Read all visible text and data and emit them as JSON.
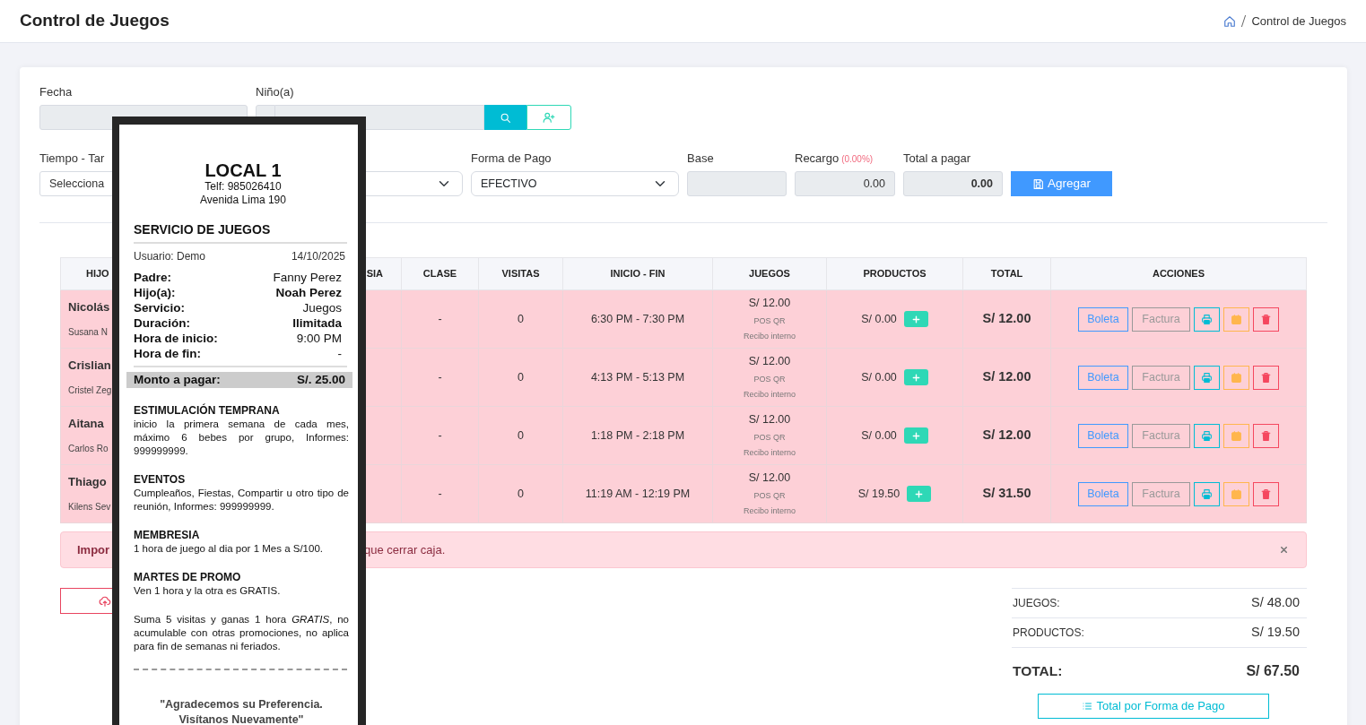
{
  "header": {
    "title": "Control de Juegos",
    "breadcrumb": [
      "Control de Juegos"
    ]
  },
  "form": {
    "fecha": {
      "label": "Fecha"
    },
    "nino": {
      "label": "Niño(a)"
    },
    "tiempo": {
      "label": "Tiempo - Tar",
      "value": "Selecciona"
    },
    "forma_pago": {
      "label": "Forma de Pago",
      "value": "EFECTIVO"
    },
    "base": {
      "label": "Base"
    },
    "recargo": {
      "label": "Recargo",
      "percent": "(0.00%)",
      "value": "0.00"
    },
    "total": {
      "label": "Total a pagar",
      "value": "0.00"
    },
    "add_button": "Agregar"
  },
  "table": {
    "columns": [
      "HIJO",
      "SIA",
      "CLASE",
      "VISITAS",
      "INICIO - FIN",
      "JUEGOS",
      "PRODUCTOS",
      "TOTAL",
      "ACCIONES"
    ],
    "rows": [
      {
        "name": "Nicolás",
        "parent": "Susana N",
        "clase": "-",
        "visitas": "0",
        "time": "6:30 PM - 7:30 PM",
        "juegos": "S/ 12.00",
        "method": "POS QR",
        "receipt": "Recibo interno",
        "productos": "S/ 0.00",
        "total": "S/ 12.00",
        "boleta": "Boleta",
        "factura": "Factura"
      },
      {
        "name": "Crislian",
        "parent": "Cristel Zeg",
        "clase": "-",
        "visitas": "0",
        "time": "4:13 PM - 5:13 PM",
        "juegos": "S/ 12.00",
        "method": "POS QR",
        "receipt": "Recibo interno",
        "productos": "S/ 0.00",
        "total": "S/ 12.00",
        "boleta": "Boleta",
        "factura": "Factura"
      },
      {
        "name": "Aitana",
        "parent": "Carlos Ro",
        "clase": "-",
        "visitas": "0",
        "time": "1:18 PM - 2:18 PM",
        "juegos": "S/ 12.00",
        "method": "POS QR",
        "receipt": "Recibo interno",
        "productos": "S/ 0.00",
        "total": "S/ 12.00",
        "boleta": "Boleta",
        "factura": "Factura"
      },
      {
        "name": "Thiago",
        "parent": "Kilens Sev",
        "clase": "-",
        "visitas": "0",
        "time": "11:19 AM - 12:19 PM",
        "juegos": "S/ 12.00",
        "method": "POS QR",
        "receipt": "Recibo interno",
        "productos": "S/ 19.50",
        "total": "S/ 31.50",
        "boleta": "Boleta",
        "factura": "Factura"
      }
    ]
  },
  "alert": {
    "start": "Impor",
    "end": "que cerrar caja."
  },
  "summary": [
    {
      "kind": "line",
      "label": "JUEGOS:",
      "value": "S/ 48.00"
    },
    {
      "kind": "line",
      "label": "PRODUCTOS:",
      "value": "S/ 19.50"
    },
    {
      "kind": "total",
      "label": "TOTAL:",
      "value": "S/ 67.50"
    }
  ],
  "summary_button": "Total por Forma de Pago",
  "ticket": {
    "store": "LOCAL 1",
    "phone": "Telf: 985026410",
    "address": "Avenida Lima 190",
    "service_title": "SERVICIO DE JUEGOS",
    "user": "Usuario: Demo",
    "date": "14/10/2025",
    "fields": [
      {
        "label": "Padre:",
        "value": "Fanny Perez",
        "bold": false
      },
      {
        "label": "Hijo(a):",
        "value": "Noah Perez",
        "bold": true
      },
      {
        "label": "Servicio:",
        "value": "Juegos",
        "bold": false
      },
      {
        "label": "Duración:",
        "value": "Ilimitada",
        "bold": true
      },
      {
        "label": "Hora de inicio:",
        "value": "9:00 PM",
        "bold": false
      },
      {
        "label": "Hora de fin:",
        "value": "-",
        "bold": false
      }
    ],
    "amount_label": "Monto a pagar:",
    "amount": "S/. 25.00",
    "sections": [
      {
        "title": "ESTIMULACIÓN TEMPRANA",
        "text": "inicio la primera semana de cada mes, máximo 6 bebes por grupo, Informes: 999999999."
      },
      {
        "title": "EVENTOS",
        "text": "Cumpleaños, Fiestas, Compartir u otro tipo de reunión, Informes: 999999999."
      },
      {
        "title": "MEMBRESIA",
        "text": "1 hora de juego al dia por 1 Mes a S/100."
      },
      {
        "title": "MARTES DE PROMO",
        "text": "Ven 1 hora y la otra es GRATIS."
      },
      {
        "text": "Suma 5 visitas y ganas 1 hora *GRATIS*, no acumulable con otras promociones, no aplica para fin de semanas ni feriados."
      }
    ],
    "thanks": "\"Agradecemos su Preferencia. Visítanos Nuevamente\""
  }
}
